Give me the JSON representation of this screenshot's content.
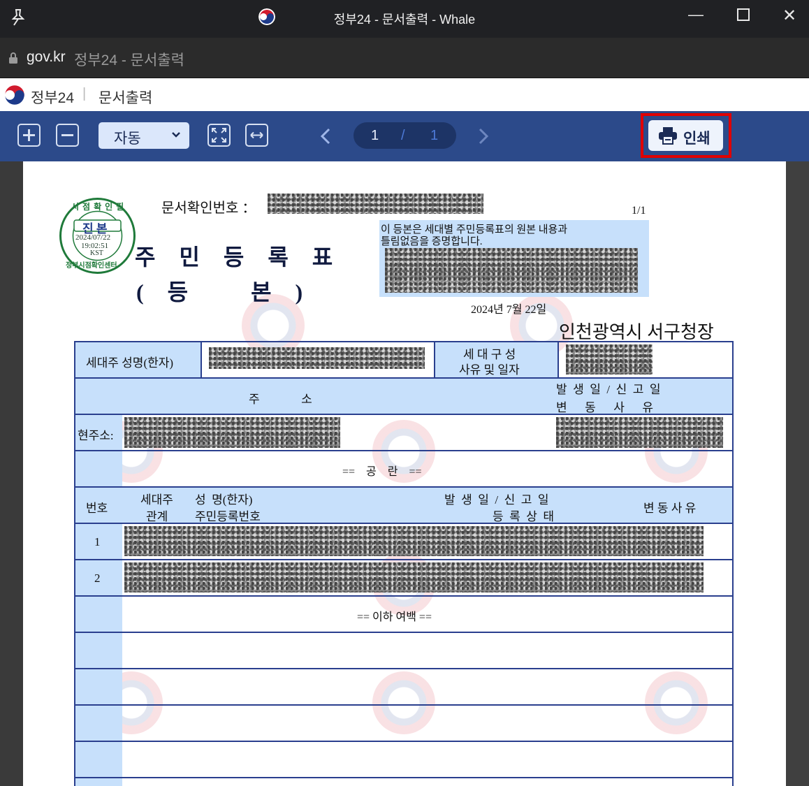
{
  "window": {
    "title": "정부24 - 문서출력 - Whale"
  },
  "address_bar": {
    "host": "gov.kr",
    "page_title": "정부24 - 문서출력"
  },
  "app": {
    "brand": "정부24",
    "separator": "|",
    "section": "문서출력"
  },
  "toolbar": {
    "zoom_in_icon": "plus-box-icon",
    "zoom_out_icon": "minus-box-icon",
    "zoom_mode": "자동",
    "fit_page_icon": "fit-page-icon",
    "fit_width_icon": "fit-width-icon",
    "page_current": "1",
    "page_sep": "/",
    "page_total": "1",
    "print_label": "인쇄"
  },
  "document": {
    "doc_no_label": "문서확인번호 ：",
    "page_indicator": "1/1",
    "stamp": {
      "top": "시 점 확 인 필",
      "center": "진 본",
      "date": "2024/07/22",
      "time": "19:02:51",
      "tz": "KST",
      "bottom": "정부시점확인센터"
    },
    "title": "주  민  등  록  표",
    "subtitle": "(  등      본  )",
    "cert_line1": "이 등본은 세대별 주민등록표의 원본 내용과",
    "cert_line2": "틀림없음을 증명합니다.",
    "issue_date": "2024년 7월 22일",
    "issuer": "인천광역시 서구청장",
    "table": {
      "householder_name_label": "세대주 성명(한자)",
      "household_comp_label1": "세 대 구 성",
      "household_comp_label2": "사유 및 일자",
      "address_label": "주              소",
      "occur_label1": "발  생  일  /  신  고  일",
      "occur_label2": "변      동      사      유",
      "current_address_label": "현주소:",
      "blank_label": "==    공    란    ==",
      "col_no": "번호",
      "col_rel1": "세대주",
      "col_rel2": "관계",
      "col_name1": "성  명(한자)",
      "col_name2": "주민등록번호",
      "col_date1": "발  생  일  /  신  고  일",
      "col_date2": "등  록  상  태",
      "col_reason": "변 동 사 유",
      "rows": [
        "1",
        "2"
      ],
      "end_label": "== 이하 여백 =="
    }
  }
}
